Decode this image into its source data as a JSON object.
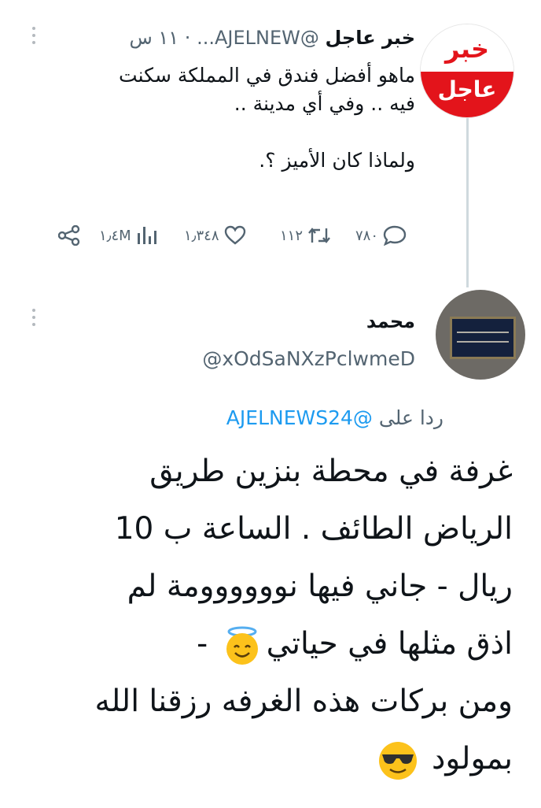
{
  "tweet1": {
    "avatar_text_top": "خبر",
    "avatar_text_bottom": "عاجل",
    "name": "خبر عاجل",
    "handle": "@AJELNEW...",
    "time": "١١ س",
    "body": [
      "ماهو أفضل فندق في المملكة سكنت",
      "فيه .. وفي أي مدينة ..",
      "",
      "ولماذا كان الأميز ؟."
    ],
    "actions": {
      "replies": "٧٨٠",
      "retweets": "١١٢",
      "likes": "١٫٣٤٨",
      "views": "١٫٤M"
    }
  },
  "tweet2": {
    "name": "محمد",
    "handle": "@xOdSaNXzPclwmeD",
    "reply_label": "ردا على",
    "reply_mention": "@AJELNEWS24",
    "body": [
      "غرفة في محطة بنزين طريق",
      "الرياض الطائف . الساعة ب 10",
      "ريال - جاني فيها نوووووومة لم",
      "اذق مثلها في حياتي",
      "ومن بركات هذه الغرفه رزقنا الله",
      "بمولود"
    ]
  },
  "colors": {
    "accent_blue": "#1d9bf0",
    "muted_text": "#536471",
    "brand_red": "#e3141b"
  },
  "icons": [
    "reply-icon",
    "retweet-icon",
    "like-icon",
    "views-icon",
    "share-icon",
    "more-icon",
    "halo-smile-emoji",
    "sunglasses-emoji"
  ]
}
